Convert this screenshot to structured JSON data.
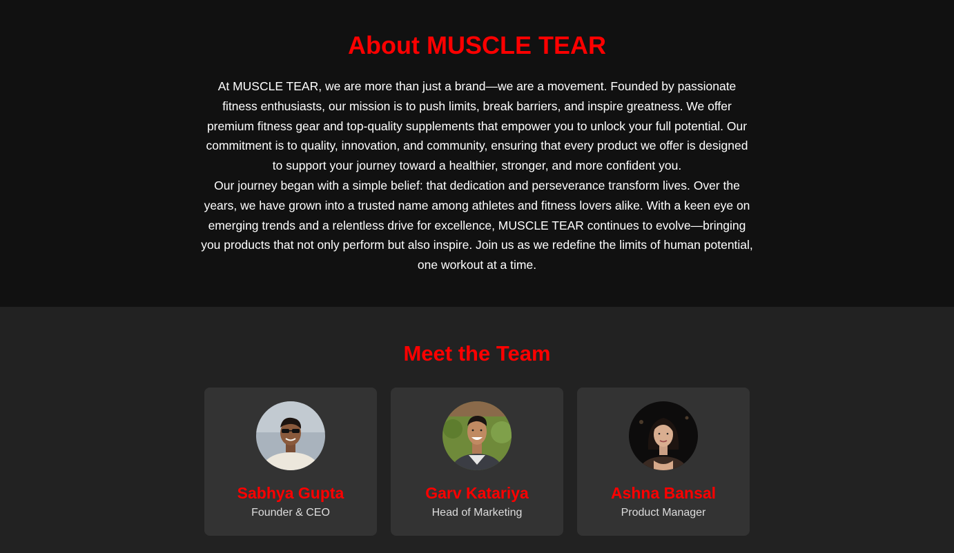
{
  "about": {
    "title": "About MUSCLE TEAR",
    "paragraphs": [
      "At MUSCLE TEAR, we are more than just a brand—we are a movement. Founded by passionate fitness enthusiasts, our mission is to push limits, break barriers, and inspire greatness. We offer premium fitness gear and top-quality supplements that empower you to unlock your full potential. Our commitment is to quality, innovation, and community, ensuring that every product we offer is designed to support your journey toward a healthier, stronger, and more confident you.",
      "Our journey began with a simple belief: that dedication and perseverance transform lives. Over the years, we have grown into a trusted name among athletes and fitness lovers alike. With a keen eye on emerging trends and a relentless drive for excellence, MUSCLE TEAR continues to evolve—bringing you products that not only perform but also inspire. Join us as we redefine the limits of human potential, one workout at a time."
    ]
  },
  "team": {
    "title": "Meet the Team",
    "members": [
      {
        "name": "Sabhya Gupta",
        "role": "Founder & CEO",
        "photo": "avatar-photo"
      },
      {
        "name": "Garv Katariya",
        "role": "Head of Marketing",
        "photo": "avatar-photo"
      },
      {
        "name": "Ashna Bansal",
        "role": "Product Manager",
        "photo": "avatar-photo"
      }
    ]
  },
  "colors": {
    "accent": "#ff0000",
    "about_bg": "#111111",
    "team_bg": "#222222",
    "card_bg": "#333333"
  }
}
